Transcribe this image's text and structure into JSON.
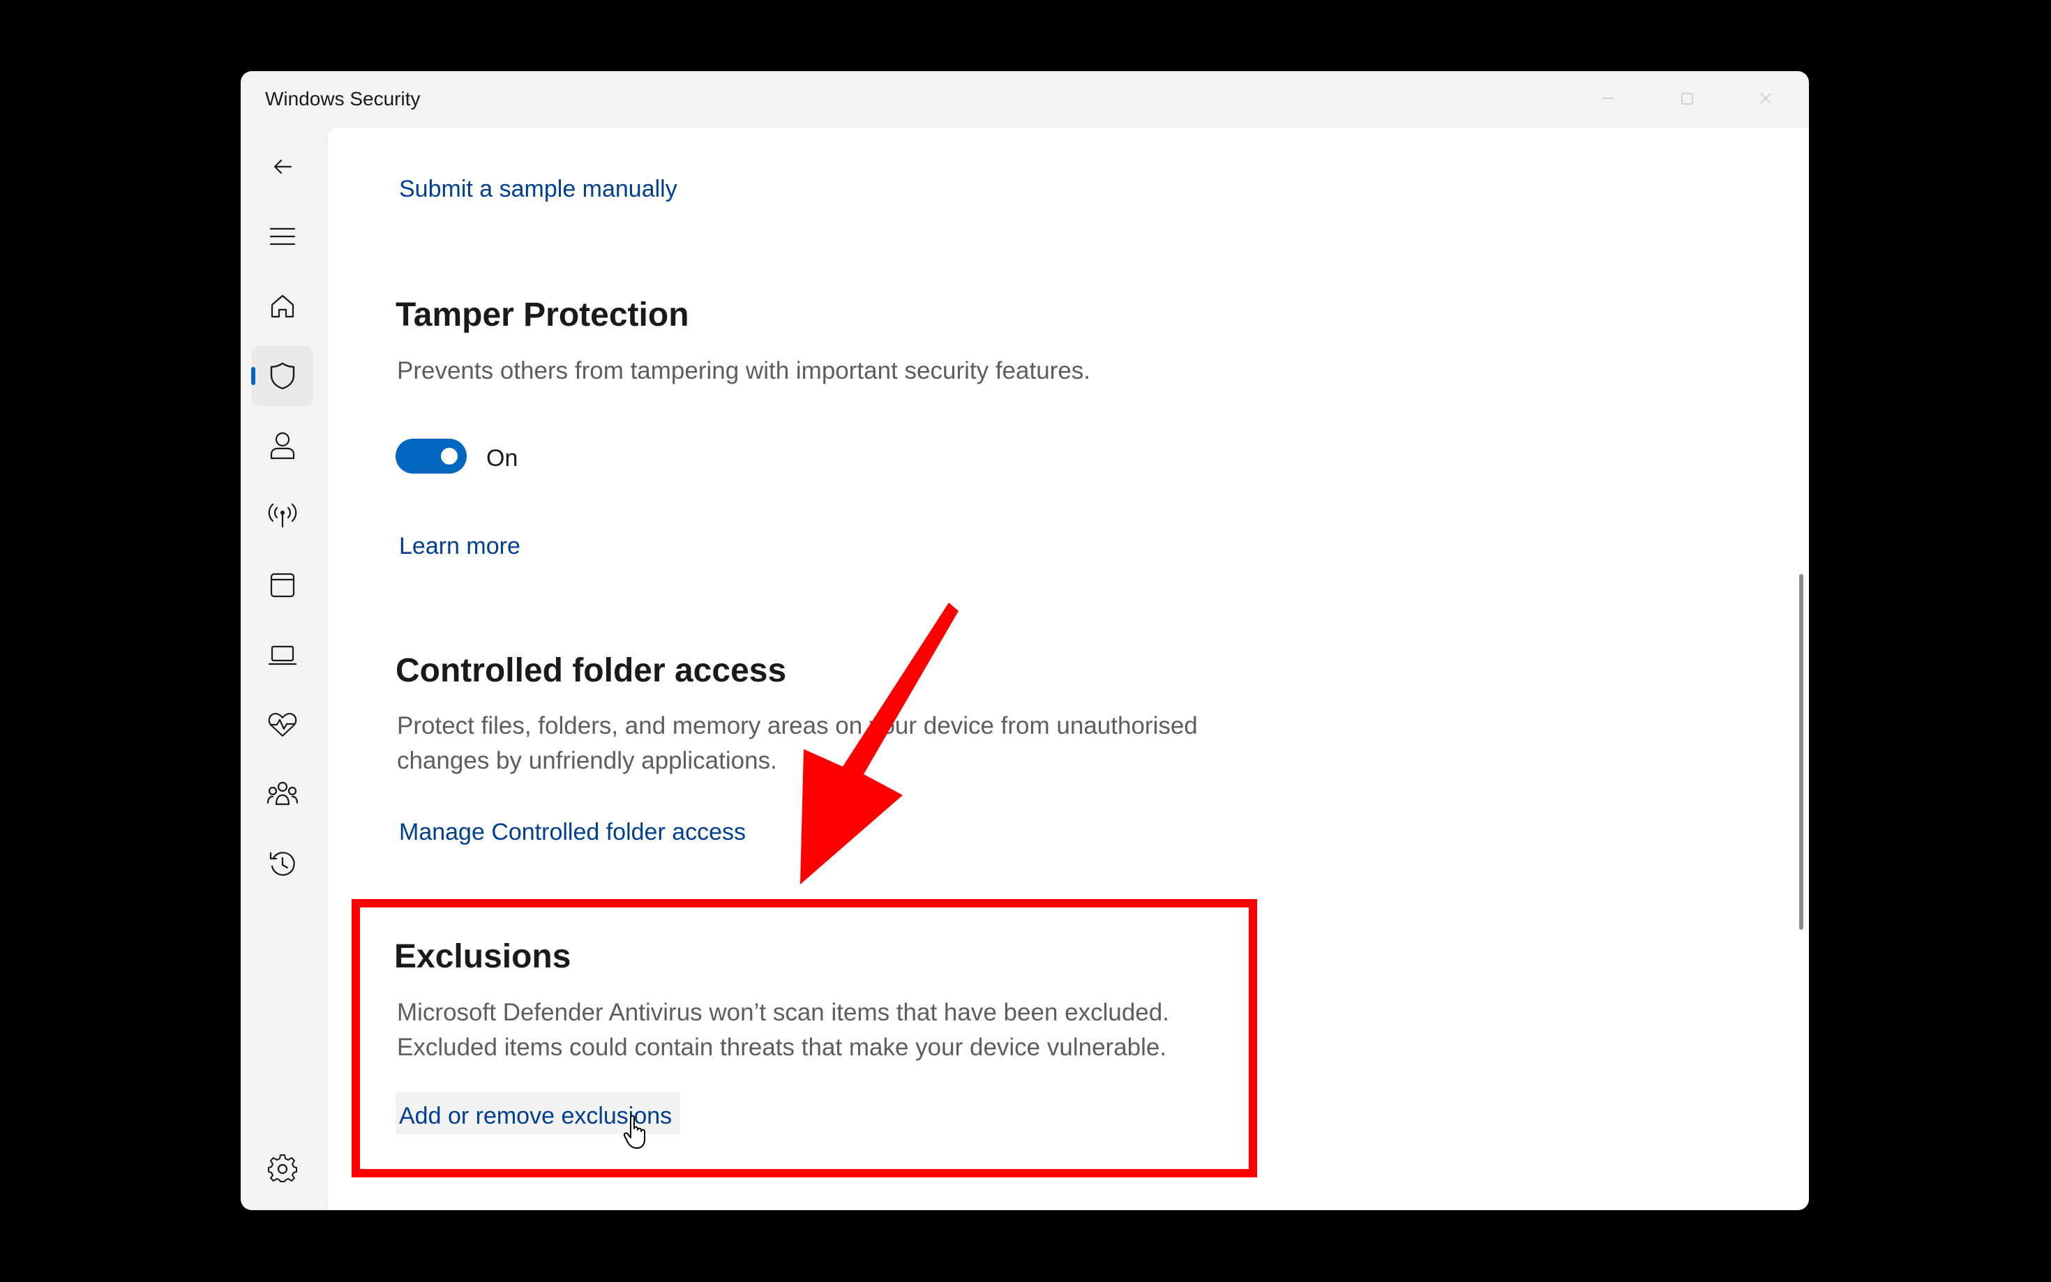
{
  "window": {
    "title": "Windows Security"
  },
  "sidebar": {
    "items": [
      {
        "icon": "back-arrow-icon"
      },
      {
        "icon": "hamburger-menu-icon"
      },
      {
        "icon": "home-icon"
      },
      {
        "icon": "shield-icon",
        "active": true
      },
      {
        "icon": "account-icon"
      },
      {
        "icon": "wireless-antenna-icon"
      },
      {
        "icon": "app-browser-icon"
      },
      {
        "icon": "laptop-icon"
      },
      {
        "icon": "heart-pulse-icon"
      },
      {
        "icon": "family-icon"
      },
      {
        "icon": "history-icon"
      },
      {
        "icon": "settings-gear-icon"
      }
    ]
  },
  "content": {
    "submit_sample_link": "Submit a sample manually",
    "tamper": {
      "title": "Tamper Protection",
      "description": "Prevents others from tampering with important security features.",
      "toggle_state": "On",
      "learn_more_link": "Learn more"
    },
    "controlled_folder": {
      "title": "Controlled folder access",
      "description": "Protect files, folders, and memory areas on your device from unauthorised changes by unfriendly applications.",
      "manage_link": "Manage Controlled folder access"
    },
    "exclusions": {
      "title": "Exclusions",
      "description_line1": "Microsoft Defender Antivirus won’t scan items that have been excluded.",
      "description_line2": "Excluded items could contain threats that make your device vulnerable.",
      "add_remove_link": "Add or remove exclusions"
    }
  },
  "annotation": {
    "color": "#ff0000"
  },
  "colors": {
    "accent": "#0067c0",
    "link": "#003e92"
  }
}
